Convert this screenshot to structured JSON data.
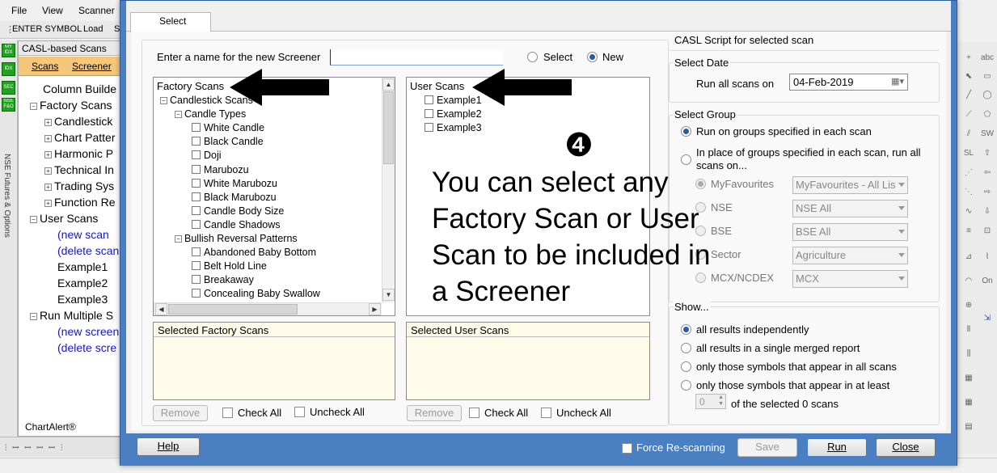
{
  "app": {
    "menu": [
      "File",
      "View",
      "Scanner"
    ],
    "toolbar": {
      "enter_symbol": "ENTER SYMBOL",
      "load": "Load",
      "cut": "S"
    },
    "left_buttons": [
      "MY IDX",
      "IDX",
      "SEC",
      "NSE F&O"
    ],
    "vertical_label": "NSE Futures & Options",
    "panel_title": "CASL-based Scans",
    "panel_tabs": {
      "scans": "Scans",
      "screener": "Screener"
    },
    "tree": [
      {
        "label": "Column Builde",
        "expander": ""
      },
      {
        "label": "Factory Scans",
        "expander": "-"
      },
      {
        "label": "Candlestick",
        "expander": "+"
      },
      {
        "label": "Chart Patter",
        "expander": "+"
      },
      {
        "label": "Harmonic P",
        "expander": "+"
      },
      {
        "label": "Technical In",
        "expander": "+"
      },
      {
        "label": "Trading Sys",
        "expander": "+"
      },
      {
        "label": "Function Re",
        "expander": "+"
      },
      {
        "label": "User Scans",
        "expander": "-"
      },
      {
        "label": "(new scan",
        "expander": ""
      },
      {
        "label": "(delete scan",
        "expander": ""
      },
      {
        "label": "Example1",
        "expander": ""
      },
      {
        "label": "Example2",
        "expander": ""
      },
      {
        "label": "Example3",
        "expander": ""
      },
      {
        "label": "Run Multiple S",
        "expander": "-"
      },
      {
        "label": "(new screen",
        "expander": ""
      },
      {
        "label": "(delete scre",
        "expander": ""
      }
    ],
    "footer_brand": "ChartAlert®"
  },
  "dialog": {
    "tab": "Select",
    "name_prompt": "Enter a name for the new Screener",
    "name_value": "",
    "mode": {
      "select": "Select",
      "new": "New",
      "selected": "new"
    },
    "factory": {
      "header": "Factory Scans",
      "items": [
        {
          "label": "Candlestick Scans",
          "level": 1,
          "expander": "-",
          "check": false
        },
        {
          "label": "Candle Types",
          "level": 2,
          "expander": "-",
          "check": false
        },
        {
          "label": "White Candle",
          "level": 3,
          "expander": "",
          "check": true
        },
        {
          "label": "Black Candle",
          "level": 3,
          "expander": "",
          "check": true
        },
        {
          "label": "Doji",
          "level": 3,
          "expander": "",
          "check": true
        },
        {
          "label": "Marubozu",
          "level": 3,
          "expander": "",
          "check": true
        },
        {
          "label": "White Marubozu",
          "level": 3,
          "expander": "",
          "check": true
        },
        {
          "label": "Black Marubozu",
          "level": 3,
          "expander": "",
          "check": true
        },
        {
          "label": "Candle Body Size",
          "level": 3,
          "expander": "",
          "check": true
        },
        {
          "label": "Candle Shadows",
          "level": 3,
          "expander": "",
          "check": true
        },
        {
          "label": "Bullish Reversal Patterns",
          "level": 2,
          "expander": "-",
          "check": false
        },
        {
          "label": "Abandoned Baby Bottom",
          "level": 3,
          "expander": "",
          "check": true
        },
        {
          "label": "Belt Hold Line",
          "level": 3,
          "expander": "",
          "check": true
        },
        {
          "label": "Breakaway",
          "level": 3,
          "expander": "",
          "check": true
        },
        {
          "label": "Concealing Baby Swallow",
          "level": 3,
          "expander": "",
          "check": true
        }
      ]
    },
    "user": {
      "header": "User Scans",
      "items": [
        "Example1",
        "Example2",
        "Example3"
      ]
    },
    "selected_factory": "Selected Factory Scans",
    "selected_user": "Selected User Scans",
    "remove": "Remove",
    "check_all": "Check All",
    "uncheck_all": "Uncheck All",
    "casl_script": "CASL Script for selected scan",
    "select_date": {
      "title": "Select Date",
      "label": "Run all scans on",
      "value": "04-Feb-2019"
    },
    "select_group": {
      "title": "Select Group",
      "opt1": "Run on groups specified in each scan",
      "opt2": "In place of groups specified in each scan, run all scans on...",
      "groups": [
        {
          "name": "MyFavourites",
          "value": "MyFavourites - All Lis",
          "on": true
        },
        {
          "name": "NSE",
          "value": "NSE All",
          "on": false
        },
        {
          "name": "BSE",
          "value": "BSE All",
          "on": false
        },
        {
          "name": "Sector",
          "value": "Agriculture",
          "on": false
        },
        {
          "name": "MCX/NCDEX",
          "value": "MCX",
          "on": false
        }
      ]
    },
    "show": {
      "title": "Show...",
      "opts": [
        "all results independently",
        "all results in a single merged report",
        "only those symbols that appear in all scans",
        "only those symbols that appear in at least"
      ],
      "spin_value": "0",
      "spin_suffix": "of the selected 0 scans"
    },
    "footer": {
      "help": "Help",
      "force": "Force Re-scanning",
      "save": "Save",
      "run": "Run",
      "close": "Close"
    }
  },
  "annotation": {
    "number": "❹",
    "text": "You can select any Factory Scan or User Scan to be included in a Screener"
  }
}
